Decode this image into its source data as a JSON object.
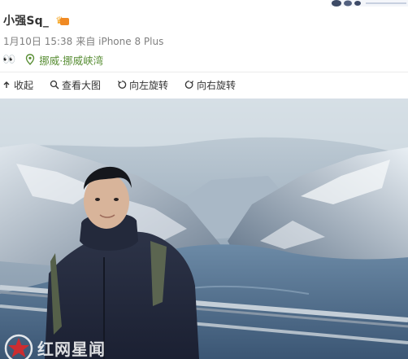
{
  "post": {
    "username": "小强Sq_",
    "date": "1月10日 15:38",
    "source": "来自 iPhone 8 Plus",
    "emoji": "👀",
    "location": "挪威·挪威峡湾"
  },
  "toolbar": {
    "collapse_label": "收起",
    "view_large_label": "查看大图",
    "rotate_left_label": "向左旋转",
    "rotate_right_label": "向右旋转"
  },
  "watermark": {
    "text": "红网星闻"
  },
  "icons": [
    "vip-crown-icon",
    "location-pin-icon",
    "collapse-arrow-icon",
    "magnifier-icon",
    "rotate-left-icon",
    "rotate-right-icon",
    "star-logo-icon"
  ],
  "colors": {
    "location_green": "#5a8f36",
    "meta_gray": "#808080",
    "username": "#333333"
  }
}
